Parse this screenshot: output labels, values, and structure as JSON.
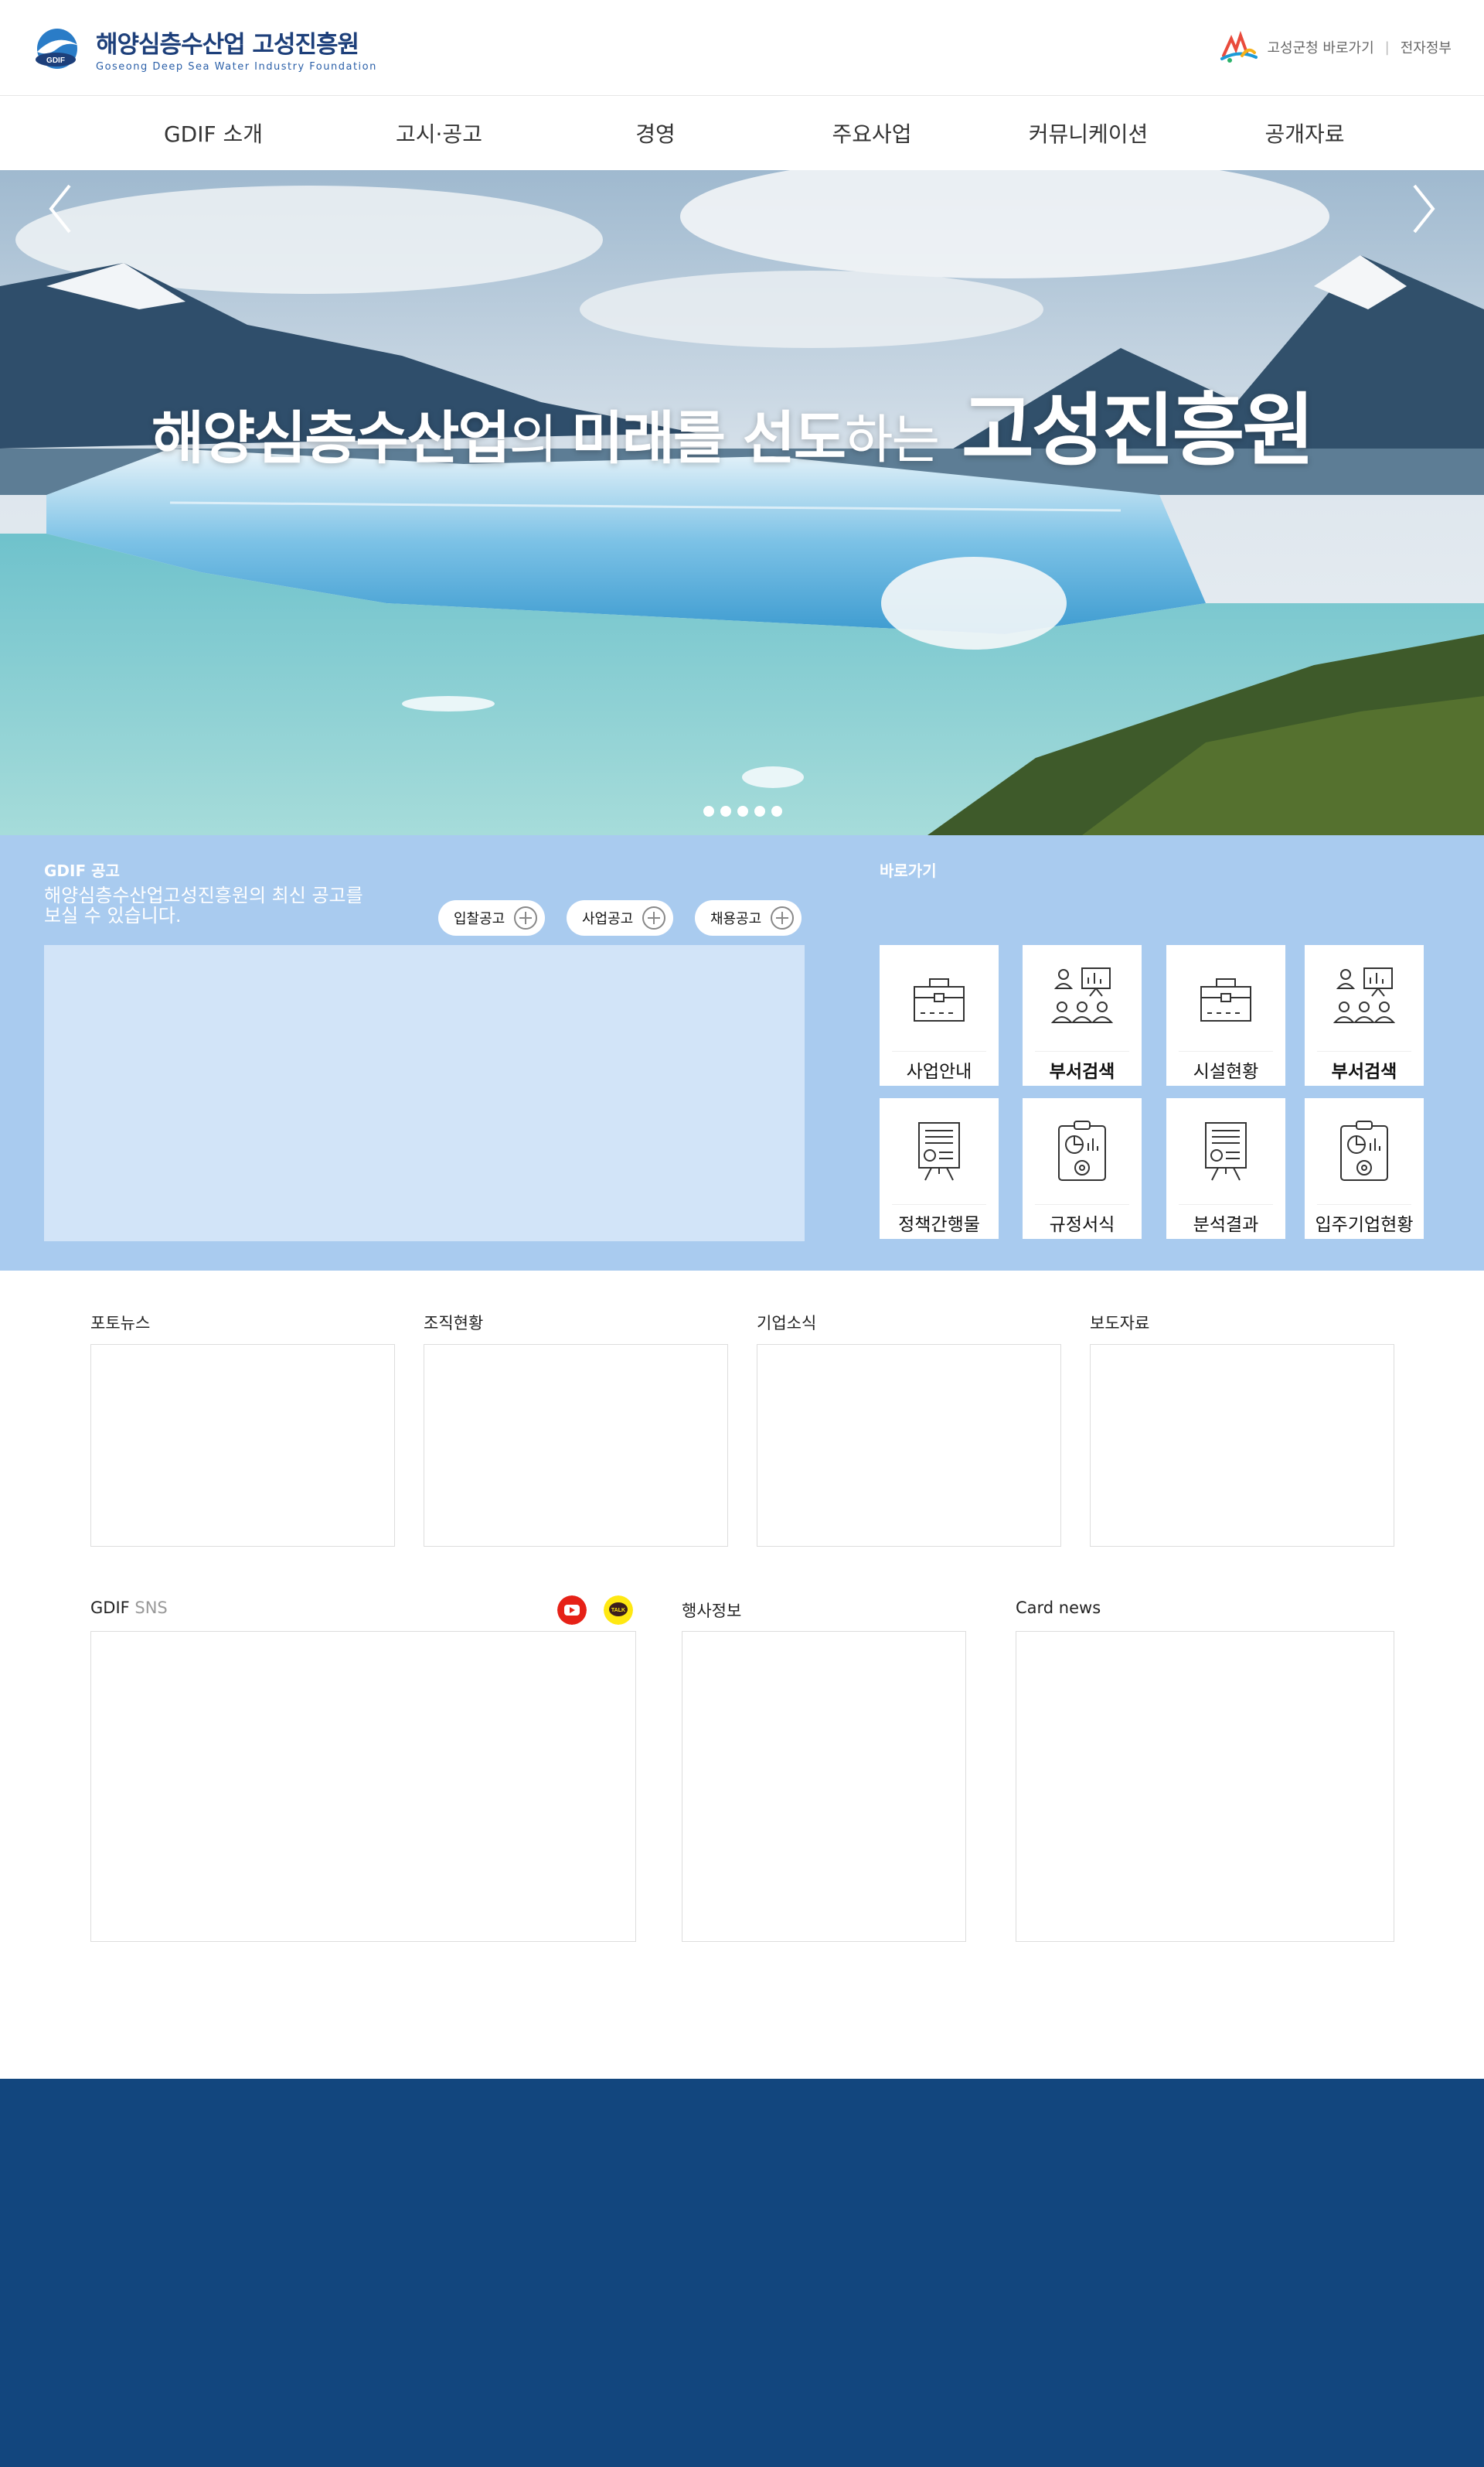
{
  "header": {
    "logo_kr": "해양심층수산업 고성진흥원",
    "logo_en": "Goseong  Deep Sea  Water Industry  Foundation",
    "logo_badge": "GDIF",
    "util_links": [
      "고성군청 바로가기",
      "전자정부"
    ],
    "util_sep": "|"
  },
  "gnb": {
    "items": [
      "GDIF 소개",
      "고시·공고",
      "경영",
      "주요사업",
      "커뮤니케이션",
      "공개자료"
    ]
  },
  "hero": {
    "title_part1": "해양심층수산업",
    "title_part2": "의 ",
    "title_part3": "미래를 선도",
    "title_part4": "하는",
    "title_part5": "고성진흥원",
    "slide_count": 5,
    "active_slide": 1
  },
  "notice": {
    "title": "GDIF 공고",
    "desc": "해양심층수산업고성진흥원의 최신 공고를 보실 수 있습니다.",
    "tabs": [
      "입찰공고",
      "사업공고",
      "채용공고"
    ]
  },
  "quick": {
    "title": "바로가기",
    "items": [
      "사업안내",
      "부서검색",
      "시설현황",
      "부서검색",
      "정책간행물",
      "규정서식",
      "분석결과",
      "입주기업현황"
    ]
  },
  "news": {
    "sections": [
      "포토뉴스",
      "조직현황",
      "기업소식",
      "보도자료"
    ]
  },
  "sns": {
    "title_bold": "GDIF",
    "title_light": " SNS",
    "icons": [
      "youtube-icon",
      "kakaotalk-icon"
    ],
    "kakao_text": "TALK"
  },
  "events": {
    "title": "행사정보"
  },
  "cardnews": {
    "title": "Card news"
  },
  "colors": {
    "brand_navy": "#1d3f7a",
    "band_blue": "#a9cbef",
    "notice_box": "#d2e4f8",
    "footer_navy": "#12467e",
    "youtube_red": "#e62117",
    "kakao_yellow": "#ffe812"
  }
}
